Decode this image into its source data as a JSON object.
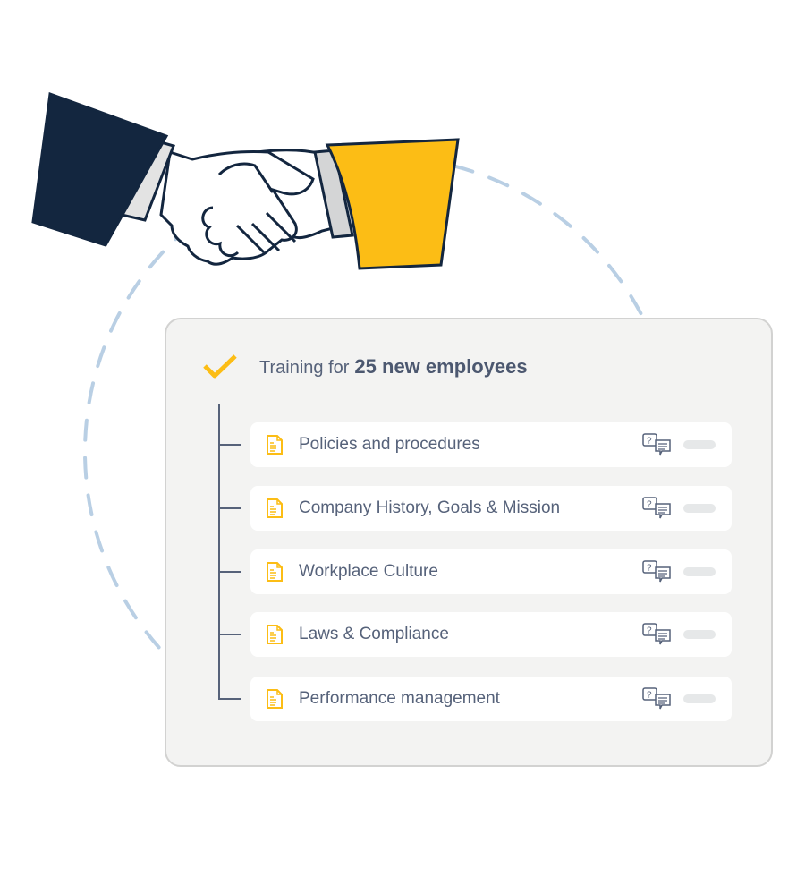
{
  "illustration": {
    "name": "handshake",
    "colors": {
      "left_sleeve": "#13263f",
      "right_sleeve": "#fcbd15",
      "cuff": "#d4d5d6",
      "outline": "#13263f",
      "dashed_circle": "#b9cfe4"
    }
  },
  "card": {
    "header": {
      "prefix": "Training for",
      "highlight": "25 new employees",
      "check_icon": "checkmark-icon",
      "check_color": "#fcbd15"
    },
    "items": [
      {
        "label": "Policies and procedures",
        "icon": "document-icon",
        "action_icon": "qa-chat-icon"
      },
      {
        "label": "Company History, Goals & Mission",
        "icon": "document-icon",
        "action_icon": "qa-chat-icon"
      },
      {
        "label": "Workplace Culture",
        "icon": "document-icon",
        "action_icon": "qa-chat-icon"
      },
      {
        "label": "Laws & Compliance",
        "icon": "document-icon",
        "action_icon": "qa-chat-icon"
      },
      {
        "label": "Performance management",
        "icon": "document-icon",
        "action_icon": "qa-chat-icon"
      }
    ],
    "colors": {
      "text": "#56627a",
      "doc_icon": "#fcbd15",
      "panel_bg": "#f3f3f2"
    }
  }
}
